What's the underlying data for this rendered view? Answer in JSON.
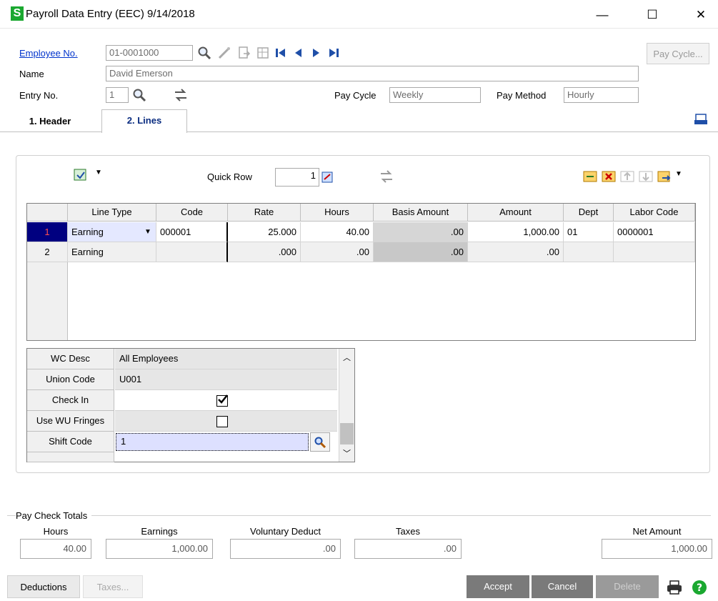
{
  "window": {
    "logo_letter": "S",
    "title": "Payroll Data Entry (EEC) 9/14/2018",
    "minimize": "—",
    "maximize": "☐",
    "close": "✕"
  },
  "header": {
    "employee_no_label": "Employee No.",
    "employee_no_value": "01-0001000",
    "name_label": "Name",
    "name_value": "David Emerson",
    "entry_no_label": "Entry No.",
    "entry_no_value": "1",
    "pay_cycle_label": "Pay Cycle",
    "pay_cycle_value": "Weekly",
    "pay_method_label": "Pay Method",
    "pay_method_value": "Hourly",
    "pay_cycle_button": "Pay Cycle..."
  },
  "tabs": [
    {
      "label": "1. Header",
      "active": false
    },
    {
      "label": "2. Lines",
      "active": true
    }
  ],
  "toolbar": {
    "quick_row_label": "Quick Row",
    "quick_row_value": "1"
  },
  "grid": {
    "columns": [
      "Line Type",
      "Code",
      "Rate",
      "Hours",
      "Basis Amount",
      "Amount",
      "Dept",
      "Labor Code"
    ],
    "rows": [
      {
        "num": "1",
        "line_type": "Earning",
        "code": "000001",
        "rate": "25.000",
        "hours": "40.00",
        "basis_amount": ".00",
        "amount": "1,000.00",
        "dept": "01",
        "labor_code": "0000001"
      },
      {
        "num": "2",
        "line_type": "Earning",
        "code": "",
        "rate": ".000",
        "hours": ".00",
        "basis_amount": ".00",
        "amount": ".00",
        "dept": "",
        "labor_code": ""
      }
    ]
  },
  "detail": {
    "wc_desc_label": "WC Desc",
    "wc_desc_value": "All Employees",
    "union_code_label": "Union Code",
    "union_code_value": "U001",
    "check_in_label": "Check In",
    "check_in_checked": true,
    "use_wu_fringes_label": "Use WU Fringes",
    "use_wu_fringes_checked": false,
    "shift_code_label": "Shift Code",
    "shift_code_value": "1"
  },
  "totals": {
    "group_label": "Pay Check Totals",
    "hours_label": "Hours",
    "hours_value": "40.00",
    "earnings_label": "Earnings",
    "earnings_value": "1,000.00",
    "voluntary_label": "Voluntary Deduct",
    "voluntary_value": ".00",
    "taxes_label": "Taxes",
    "taxes_value": ".00",
    "net_label": "Net Amount",
    "net_value": "1,000.00"
  },
  "buttons": {
    "deductions": "Deductions",
    "taxes": "Taxes...",
    "accept": "Accept",
    "cancel": "Cancel",
    "delete": "Delete"
  },
  "colors": {
    "accent": "#1aa830",
    "link": "#0033cc",
    "dark_button": "#7a7a7a",
    "selected_row": "#000080"
  }
}
